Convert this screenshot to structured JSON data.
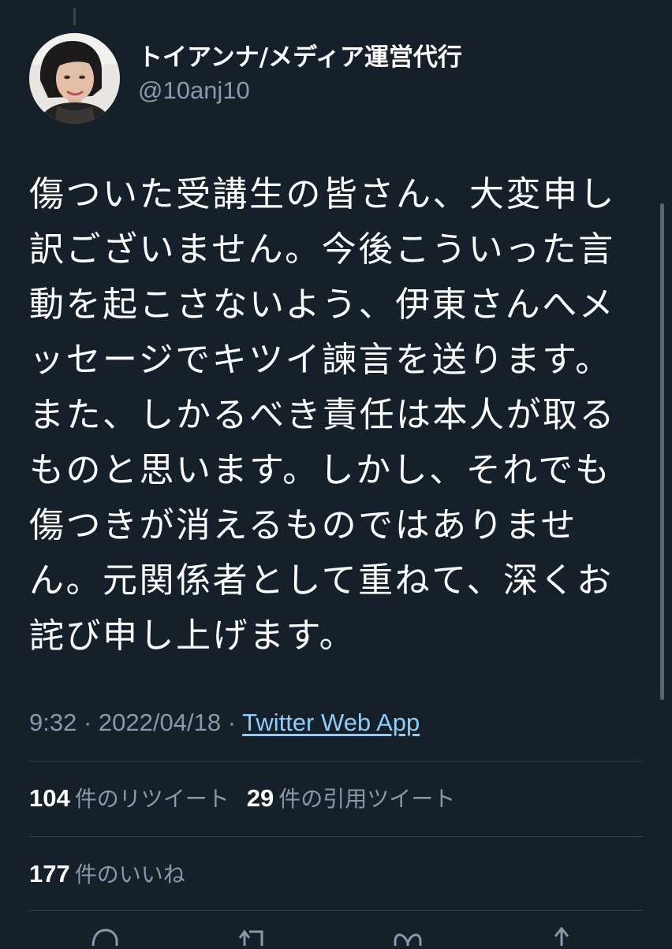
{
  "user": {
    "display_name": "トイアンナ/メディア運営代行",
    "handle": "@10anj10"
  },
  "tweet": {
    "text_lines": [
      "傷ついた受講生の皆さん、大変申し",
      "訳ございません。今後こういった言",
      "動を起こさないよう、伊東さんへメ",
      "ッセージでキツイ諫言を送ります。",
      "また、しかるべき責任は本人が取る",
      "ものと思います。しかし、それでも",
      "傷つきが消えるものではありませ",
      "ん。元関係者として重ねて、深くお",
      "詫び申し上げます。"
    ],
    "time": "9:32",
    "date": "2022/04/18",
    "separator": "·",
    "source": "Twitter Web App"
  },
  "stats": {
    "retweets_count": "104",
    "retweets_label": "件のリツイート",
    "quotes_count": "29",
    "quotes_label": "件の引用ツイート",
    "likes_count": "177",
    "likes_label": "件のいいね"
  },
  "actions": [
    "reply-icon",
    "retweet-icon",
    "like-icon",
    "share-icon"
  ],
  "colors": {
    "background": "#15202b",
    "text_primary": "#ffffff",
    "text_secondary": "#8b98a5",
    "link": "#8ecdf8",
    "divider": "#38444d"
  }
}
